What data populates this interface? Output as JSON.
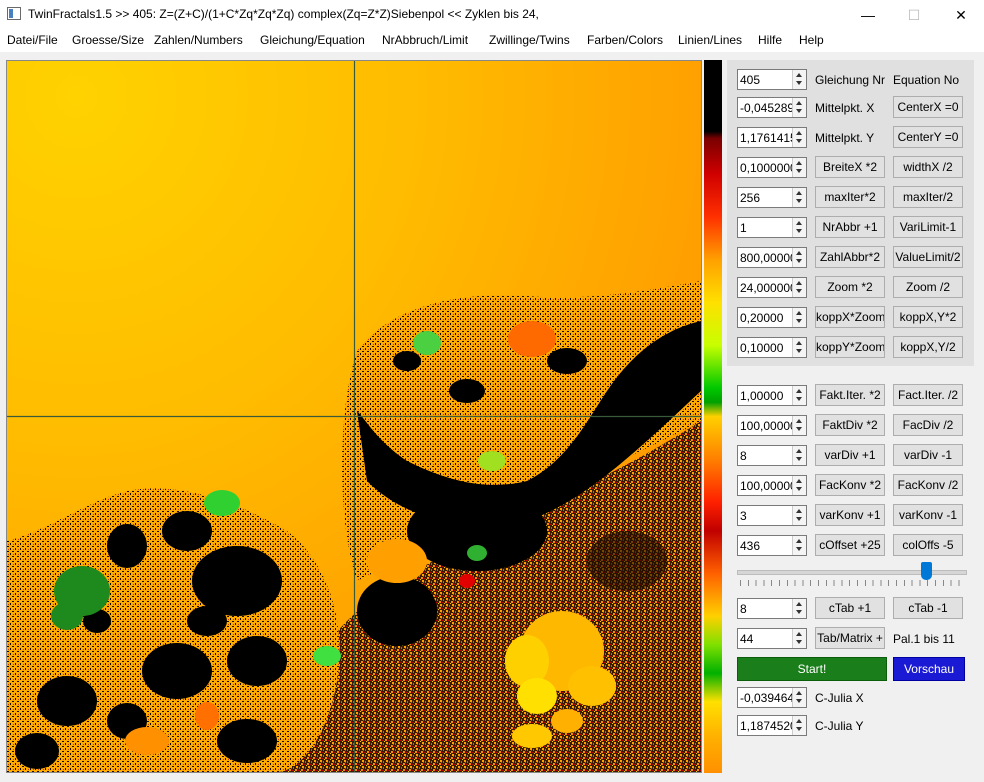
{
  "window": {
    "title": "TwinFractals1.5 >> 405: Z=(Z+C)/(1+C*Zq*Zq*Zq) complex(Zq=Z*Z)Siebenpol <<  Zyklen bis 24,",
    "minimize_glyph": "—",
    "maximize_glyph": "☐",
    "close_glyph": "✕"
  },
  "menu": [
    "Datei/File",
    "Groesse/Size",
    "Zahlen/Numbers",
    "Gleichung/Equation",
    "NrAbbruch/Limit",
    "Zwillinge/Twins",
    "Farben/Colors",
    "Linien/Lines",
    "Hilfe",
    "Help"
  ],
  "params": {
    "equation_nr": {
      "value": "405",
      "label": "Gleichung Nr",
      "label2": "Equation No"
    },
    "center_x": {
      "value": "-0,0452890",
      "label": "Mittelpkt. X",
      "button": "CenterX =0"
    },
    "center_y": {
      "value": "1,1761415",
      "label": "Mittelpkt. Y",
      "button": "CenterY =0"
    },
    "width": {
      "value": "0,1000000",
      "btn1": "BreiteX *2",
      "btn2": "widthX /2"
    },
    "max_iter": {
      "value": "256",
      "btn1": "maxIter*2",
      "btn2": "maxIter/2"
    },
    "nr_abbr": {
      "value": "1",
      "btn1": "NrAbbr +1",
      "btn2": "VariLimit-1"
    },
    "zahl_abbr": {
      "value": "800,000000",
      "btn1": "ZahlAbbr*2",
      "btn2": "ValueLimit/2"
    },
    "zoom": {
      "value": "24,000000",
      "btn1": "Zoom *2",
      "btn2": "Zoom /2"
    },
    "kopp_x": {
      "value": "0,20000",
      "btn1": "koppX*Zoom",
      "btn2": "koppX,Y*2"
    },
    "kopp_y": {
      "value": "0,10000",
      "btn1": "koppY*Zoom",
      "btn2": "koppX,Y/2"
    },
    "fakt_iter": {
      "value": "1,00000",
      "btn1": "Fakt.Iter. *2",
      "btn2": "Fact.Iter. /2"
    },
    "fakt_div": {
      "value": "100,00000",
      "btn1": "FaktDiv *2",
      "btn2": "FacDiv /2"
    },
    "var_div": {
      "value": "8",
      "btn1": "varDiv +1",
      "btn2": "varDiv -1"
    },
    "fac_konv": {
      "value": "100,00000",
      "btn1": "FacKonv *2",
      "btn2": "FacKonv /2"
    },
    "var_konv": {
      "value": "3",
      "btn1": "varKonv +1",
      "btn2": "varKonv -1"
    },
    "c_offset": {
      "value": "436",
      "btn1": "cOffset +25",
      "btn2": "colOffs -5"
    },
    "c_tab": {
      "value": "8",
      "btn1": "cTab +1",
      "btn2": "cTab -1"
    },
    "tab_matrix": {
      "value": "44",
      "btn1": "Tab/Matrix +",
      "label": "Pal.1 bis 11"
    },
    "c_julia_x": {
      "value": "-0,0394649",
      "label": "C-Julia X"
    },
    "c_julia_y": {
      "value": "1,1874520",
      "label": "C-Julia Y"
    }
  },
  "slider": {
    "value_fraction": 0.85
  },
  "actions": {
    "start": "Start!",
    "preview": "Vorschau"
  }
}
